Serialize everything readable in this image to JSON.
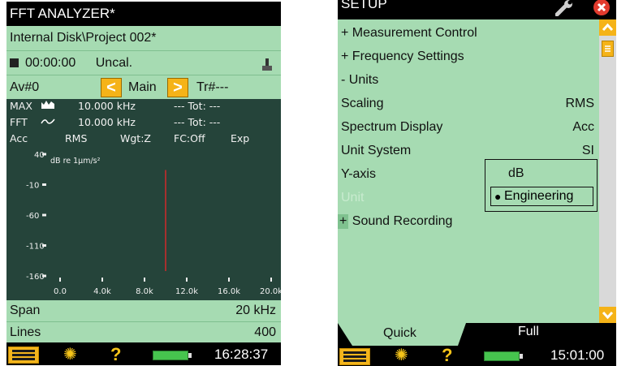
{
  "left_screen": {
    "title": "FFT ANALYZER*",
    "path": "Internal Disk\\Project 002*",
    "elapsed_time": "00:00:00",
    "calibration_status": "Uncal.",
    "averages": "Av#0",
    "view_name": "Main",
    "trigger": "Tr#---",
    "readouts": [
      {
        "label": "MAX",
        "freq": "10.000 kHz",
        "tot": "--- Tot: ---"
      },
      {
        "label": "FFT",
        "freq": "10.000 kHz",
        "tot": "--- Tot: ---"
      }
    ],
    "settings_line": [
      "Acc",
      "RMS",
      "Wgt:Z",
      "FC:Off",
      "Exp"
    ],
    "chart_data": {
      "type": "line",
      "ylabel": "dB re 1µm/s²",
      "y_ticks": [
        "40",
        "-10",
        "-60",
        "-110",
        "-160"
      ],
      "x_ticks": [
        "0.0",
        "4.0k",
        "8.0k",
        "12.0k",
        "16.0k",
        "20.0k"
      ],
      "x_range": [
        0,
        20000
      ],
      "y_range": [
        -160,
        40
      ],
      "cursor_frequency": 10000,
      "series_color": "#d12a2a"
    },
    "span": {
      "label": "Span",
      "value": "20 kHz"
    },
    "lines": {
      "label": "Lines",
      "value": "400"
    },
    "clock": "16:28:37"
  },
  "right_screen": {
    "title": "SETUP",
    "items": [
      {
        "prefix": "+",
        "label": "Measurement Control"
      },
      {
        "prefix": "+",
        "label": "Frequency Settings"
      },
      {
        "prefix": "-",
        "label": "Units"
      }
    ],
    "params": [
      {
        "label": "Scaling",
        "value": "RMS"
      },
      {
        "label": "Spectrum Display",
        "value": "Acc"
      },
      {
        "label": "Unit System",
        "value": "SI"
      },
      {
        "label": "Y-axis",
        "value": ""
      }
    ],
    "unit_label": "Unit",
    "sound_recording": {
      "prefix": "+",
      "label": "Sound Recording"
    },
    "dropdown_options": [
      "dB",
      "Engineering"
    ],
    "dropdown_selected": "Engineering",
    "tabs": [
      "Quick",
      "Full"
    ],
    "clock": "15:01:00"
  },
  "colors": {
    "panel_green": "#a6dbb2",
    "dark_green": "#25443a",
    "accent_orange": "#f5b318",
    "close_red": "#e23b2e"
  }
}
